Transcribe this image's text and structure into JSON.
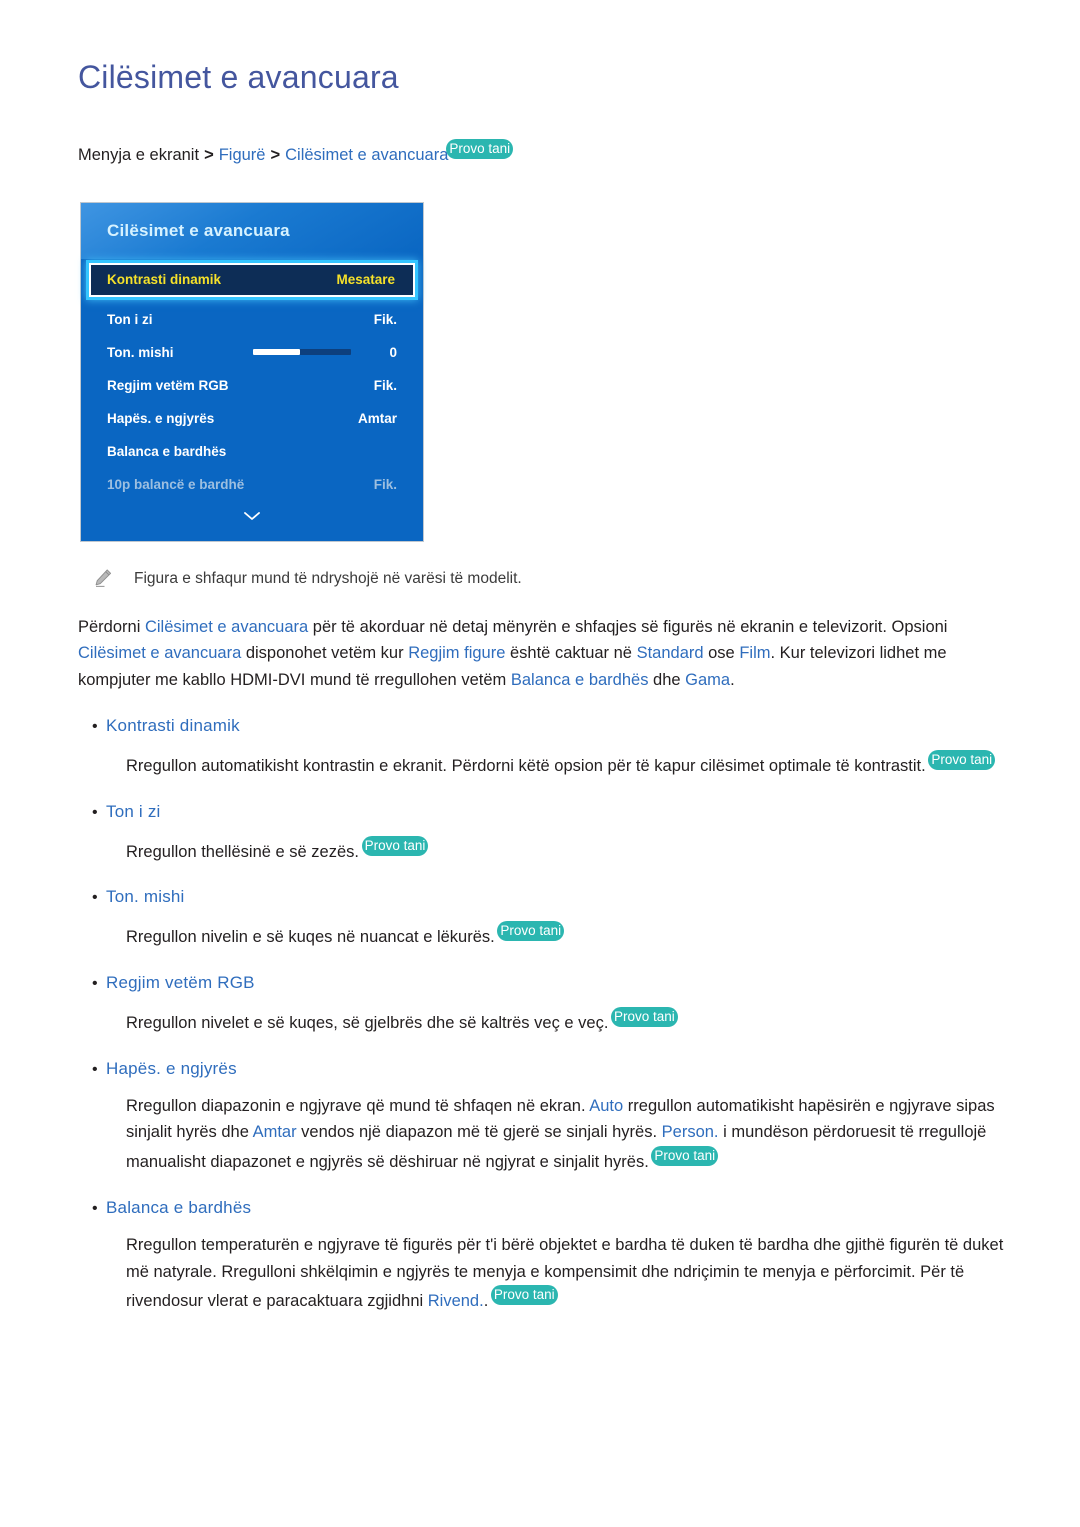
{
  "colors": {
    "title": "#44569e",
    "link": "#2f6dbd",
    "pill_bg": "#2bb6b0",
    "menu_bg": "#0a66c2",
    "menu_selected_bg": "#0d2d56",
    "menu_selected_text": "#f5e12a",
    "menu_glow": "#35c6ff",
    "text": "#231f20"
  },
  "page_title": "Cilësimet e avancuara",
  "breadcrumb": {
    "root": "Menyja e ekranit",
    "sep": ">",
    "crumb1": "Figurë",
    "crumb2": "Cilësimet e avancuara",
    "pill": "Provo tani"
  },
  "tv_menu": {
    "title": "Cilësimet e avancuara",
    "rows": [
      {
        "label": "Kontrasti dinamik",
        "value": "Mesatare",
        "state": "selected",
        "type": "value"
      },
      {
        "label": "Ton i zi",
        "value": "Fik.",
        "state": "normal",
        "type": "value"
      },
      {
        "label": "Ton. mishi",
        "value": "0",
        "state": "normal",
        "type": "slider",
        "slider_percent": 48
      },
      {
        "label": "Regjim vetëm RGB",
        "value": "Fik.",
        "state": "normal",
        "type": "value"
      },
      {
        "label": "Hapës. e ngjyrës",
        "value": "Amtar",
        "state": "normal",
        "type": "value"
      },
      {
        "label": "Balanca e bardhës",
        "value": "",
        "state": "normal",
        "type": "value"
      },
      {
        "label": "10p balancë e bardhë",
        "value": "Fik.",
        "state": "dimmed",
        "type": "value"
      }
    ],
    "more_icon": "chevron-down-icon"
  },
  "note": {
    "icon": "pencil-icon",
    "text": "Figura e shfaqur mund të ndryshojë në varësi të modelit."
  },
  "intro": {
    "s1": "Përdorni ",
    "l1": "Cilësimet e avancuara",
    "s2": " për të akorduar në detaj mënyrën e shfaqjes së figurës në ekranin e televizorit. Opsioni ",
    "l2": "Cilësimet e avancuara",
    "s3": " disponohet vetëm kur ",
    "l3": "Regjim figure",
    "s4": " është caktuar në ",
    "l4": "Standard",
    "s5": " ose ",
    "l5": "Film",
    "s6": ". Kur televizori lidhet me kompjuter me kabllo HDMI-DVI mund të rregullohen vetëm ",
    "l6": "Balanca e bardhës",
    "s7": " dhe ",
    "l7": "Gama",
    "s8": "."
  },
  "bullets": [
    {
      "title": "Kontrasti dinamik",
      "body_1": "Rregullon automatikisht kontrastin e ekranit. Përdorni këtë opsion për të kapur cilësimet optimale të kontrastit. ",
      "pill": "Provo tani"
    },
    {
      "title": "Ton i zi",
      "body_1": "Rregullon thellësinë e së zezës. ",
      "pill": "Provo tani"
    },
    {
      "title": "Ton. mishi",
      "body_1": "Rregullon nivelin e së kuqes në nuancat e lëkurës. ",
      "pill": "Provo tani"
    },
    {
      "title": "Regjim vetëm RGB",
      "body_1": "Rregullon nivelet e së kuqes, së gjelbrës dhe së kaltrës veç e veç. ",
      "pill": "Provo tani"
    },
    {
      "title": "Hapës. e ngjyrës",
      "body_1": "Rregullon diapazonin e ngjyrave që mund të shfaqen në ekran. ",
      "link_1": "Auto",
      "body_2": " rregullon automatikisht hapësirën e ngjyrave sipas sinjalit hyrës dhe ",
      "link_2": "Amtar",
      "body_3": " vendos një diapazon më të gjerë se sinjali hyrës. ",
      "link_3": "Person.",
      "body_4": " i mundëson përdoruesit të rregullojë manualisht diapazonet e ngjyrës së dëshiruar në ngjyrat e sinjalit hyrës. ",
      "pill": "Provo tani"
    },
    {
      "title": "Balanca e bardhës",
      "body_1": "Rregullon temperaturën e ngjyrave të figurës për t'i bërë objektet e bardha të duken të bardha dhe gjithë figurën të duket më natyrale. Rregulloni shkëlqimin e ngjyrës te menyja e kompensimit dhe ndriçimin te menyja e përforcimit. Për të rivendosur vlerat e paracaktuara zgjidhni ",
      "link_1": "Rivend.",
      "body_2": ". ",
      "pill": "Provo tani"
    }
  ]
}
